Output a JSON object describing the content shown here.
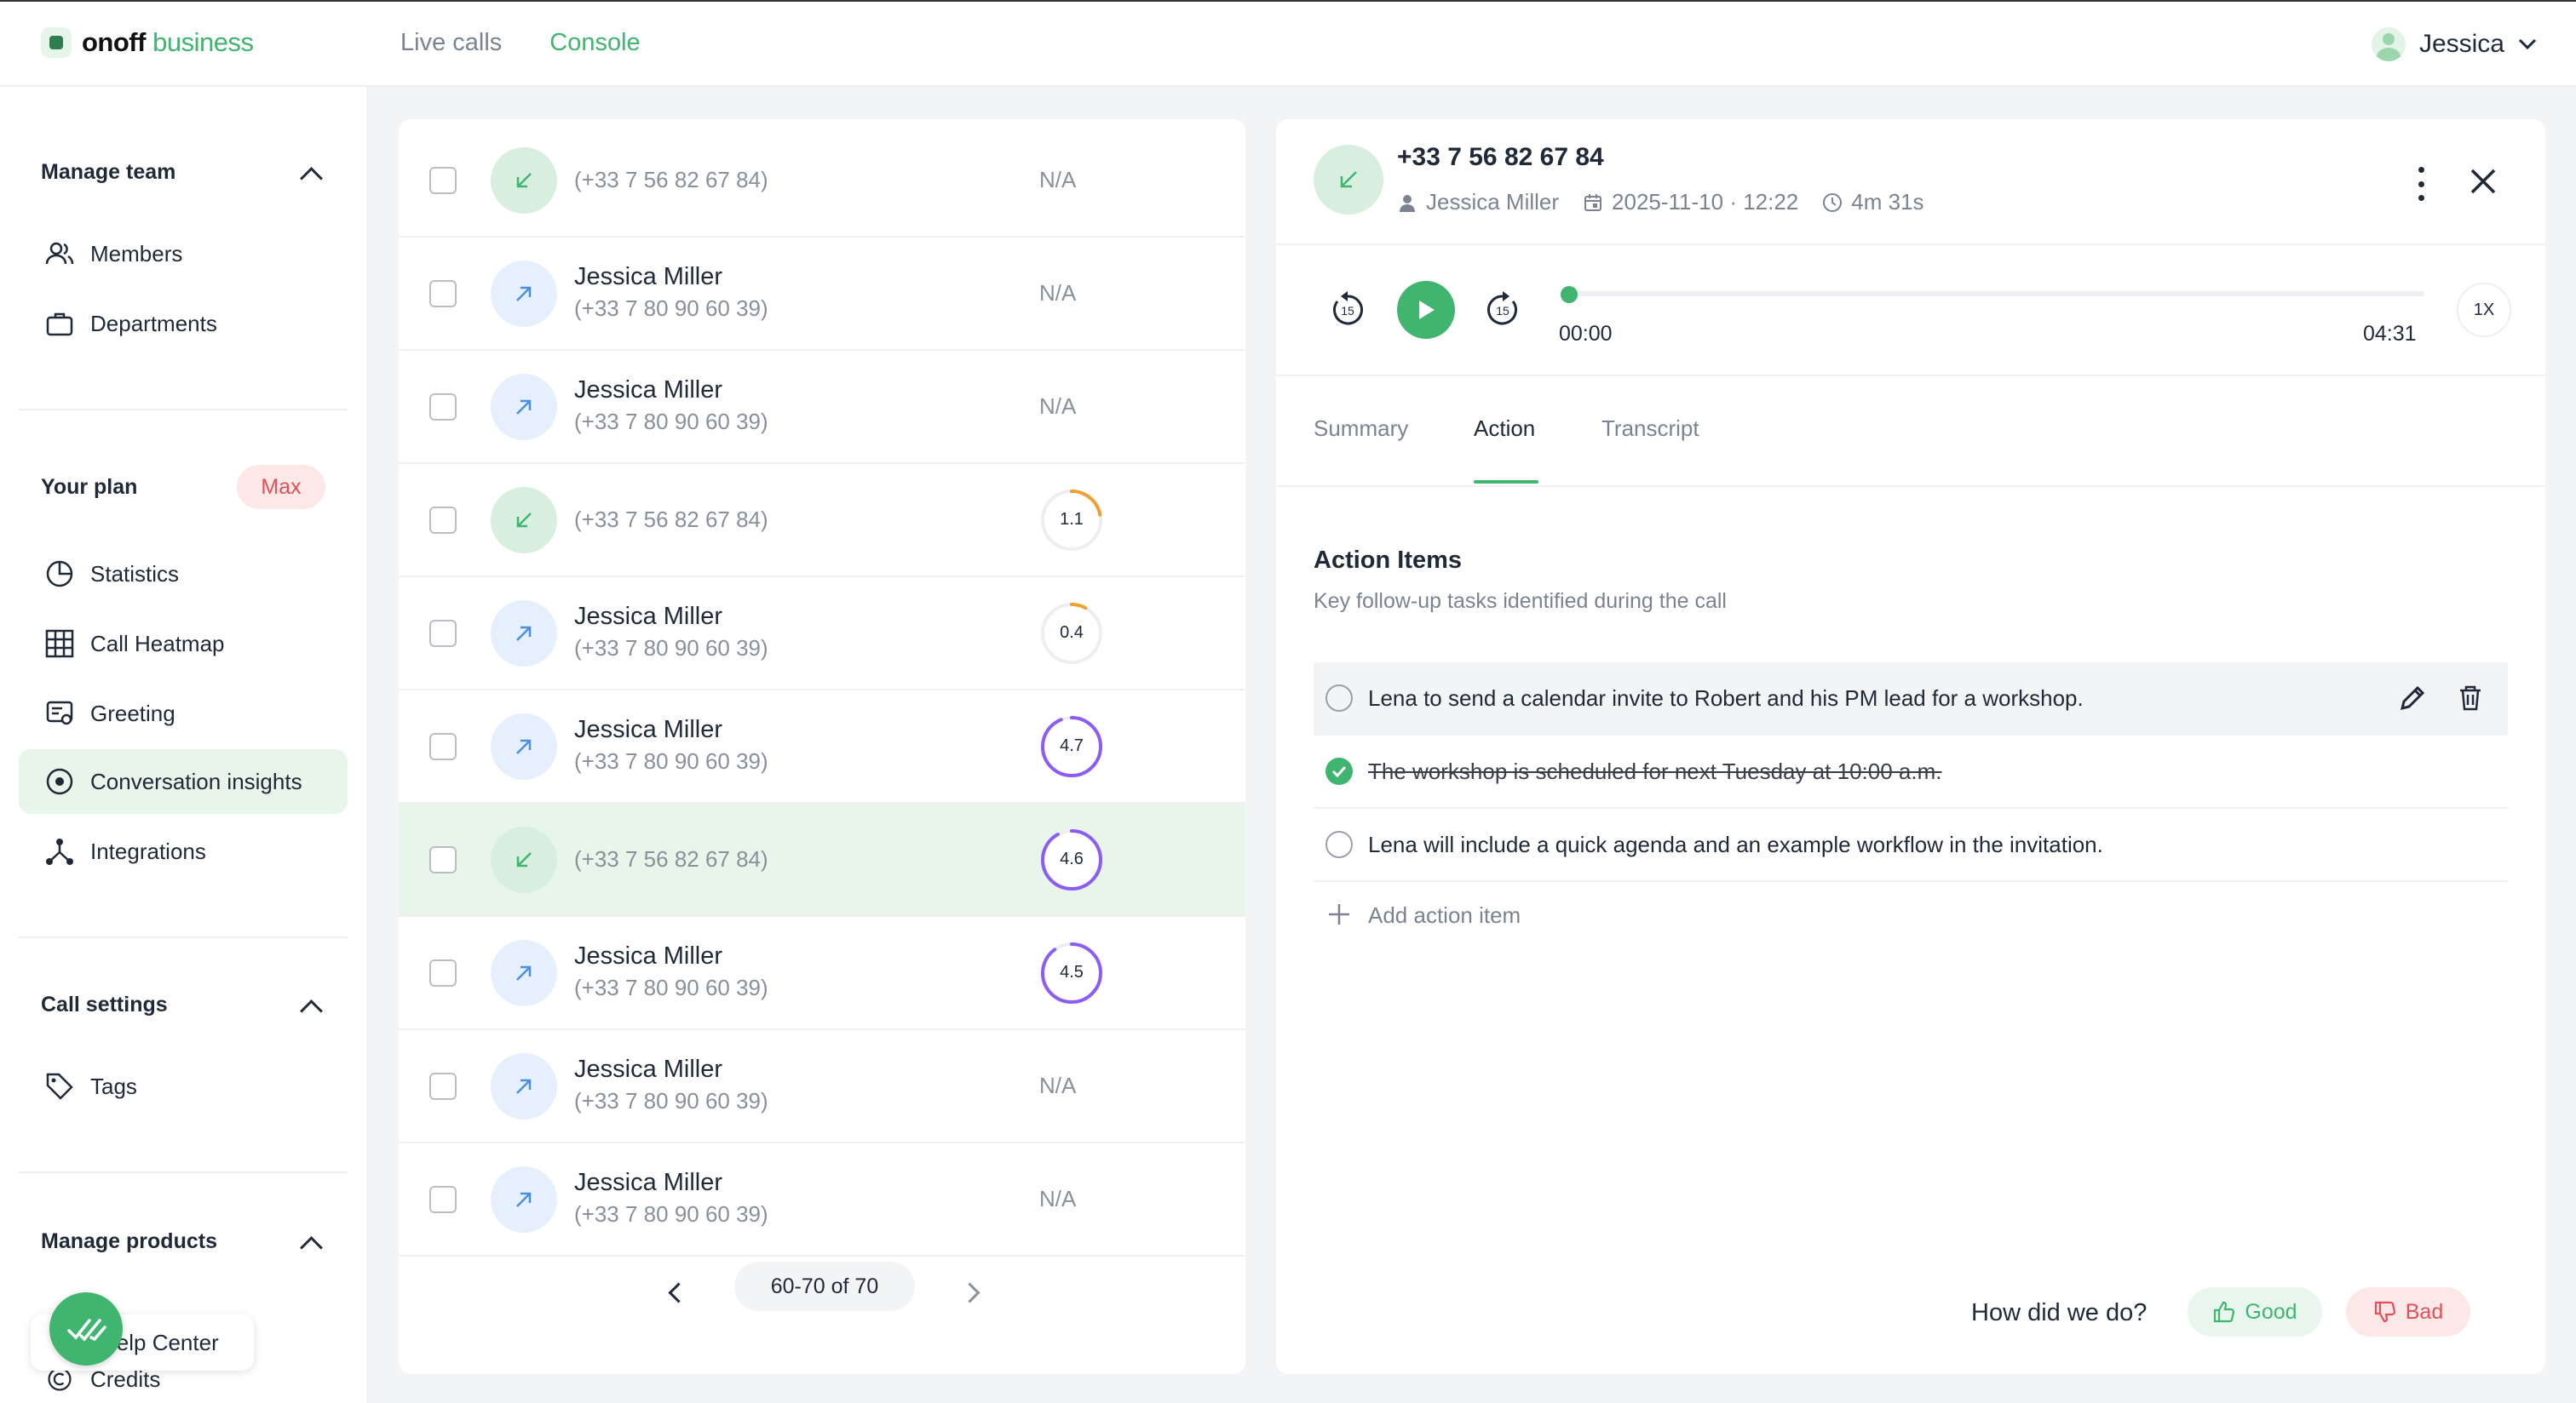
{
  "brand": {
    "name_bold": "onoff",
    "name_light": "business"
  },
  "topnav": {
    "live_calls": "Live calls",
    "console": "Console"
  },
  "user": {
    "name": "Jessica"
  },
  "sidebar": {
    "manage_team": {
      "title": "Manage team",
      "items": [
        {
          "label": "Members",
          "icon": "users-icon"
        },
        {
          "label": "Departments",
          "icon": "briefcase-icon"
        }
      ]
    },
    "plan": {
      "title": "Your plan",
      "badge": "Max",
      "items": [
        {
          "label": "Statistics",
          "icon": "pie-chart-icon"
        },
        {
          "label": "Call Heatmap",
          "icon": "grid-icon"
        },
        {
          "label": "Greeting",
          "icon": "greeting-icon"
        },
        {
          "label": "Conversation insights",
          "icon": "target-icon",
          "active": true
        },
        {
          "label": "Integrations",
          "icon": "integrations-icon"
        }
      ]
    },
    "call_settings": {
      "title": "Call settings",
      "items": [
        {
          "label": "Tags",
          "icon": "tag-icon"
        }
      ]
    },
    "manage_products": {
      "title": "Manage products",
      "items": [
        {
          "label": "Help Center",
          "icon": "help-icon"
        },
        {
          "label": "Credits",
          "icon": "credits-icon"
        }
      ]
    }
  },
  "calls": [
    {
      "dir": "incoming",
      "name": "",
      "phone": "(+33 7 56 82 67 84)",
      "score": "N/A"
    },
    {
      "dir": "outgoing",
      "name": "Jessica Miller",
      "phone": "(+33 7 80 90 60 39)",
      "score": "N/A"
    },
    {
      "dir": "outgoing",
      "name": "Jessica Miller",
      "phone": "(+33 7 80 90 60 39)",
      "score": "N/A"
    },
    {
      "dir": "incoming",
      "name": "",
      "phone": "(+33 7 56 82 67 84)",
      "score": "1.1",
      "score_fraction": 0.22,
      "score_color": "#f0a030"
    },
    {
      "dir": "outgoing",
      "name": "Jessica Miller",
      "phone": "(+33 7 80 90 60 39)",
      "score": "0.4",
      "score_fraction": 0.08,
      "score_color": "#f0a030"
    },
    {
      "dir": "outgoing",
      "name": "Jessica Miller",
      "phone": "(+33 7 80 90 60 39)",
      "score": "4.7",
      "score_fraction": 0.94,
      "score_color": "#8b5cf6"
    },
    {
      "dir": "incoming",
      "name": "",
      "phone": "(+33 7 56 82 67 84)",
      "score": "4.6",
      "score_fraction": 0.92,
      "score_color": "#8b5cf6",
      "selected": true
    },
    {
      "dir": "outgoing",
      "name": "Jessica Miller",
      "phone": "(+33 7 80 90 60 39)",
      "score": "4.5",
      "score_fraction": 0.9,
      "score_color": "#8b5cf6"
    },
    {
      "dir": "outgoing",
      "name": "Jessica Miller",
      "phone": "(+33 7 80 90 60 39)",
      "score": "N/A"
    },
    {
      "dir": "outgoing",
      "name": "Jessica Miller",
      "phone": "(+33 7 80 90 60 39)",
      "score": "N/A"
    }
  ],
  "pagination": {
    "range": "60-70 of 70"
  },
  "detail": {
    "phone": "+33 7 56 82 67 84",
    "contact": "Jessica Miller",
    "datetime": "2025-11-10 · 12:22",
    "duration": "4m 31s",
    "player": {
      "current": "00:00",
      "total": "04:31",
      "speed": "1X",
      "skip_back": "15",
      "skip_forward": "15",
      "progress": 0
    },
    "tabs": [
      {
        "label": "Summary"
      },
      {
        "label": "Action",
        "active": true
      },
      {
        "label": "Transcript"
      }
    ],
    "action_items": {
      "title": "Action Items",
      "subtitle": "Key follow-up tasks identified during the call",
      "items": [
        {
          "text": "Lena to send a calendar invite to Robert and his PM lead for a workshop.",
          "done": false
        },
        {
          "text": "The workshop is scheduled for next Tuesday at 10:00 a.m.",
          "done": true
        },
        {
          "text": "Lena will include a quick agenda and an example workflow in the invitation.",
          "done": false
        }
      ],
      "add_label": "Add action item"
    },
    "feedback": {
      "question": "How did we do?",
      "good": "Good",
      "bad": "Bad"
    }
  },
  "colors": {
    "accent": "#3fb56f",
    "danger": "#e0505a",
    "score_high": "#8b5cf6",
    "score_low": "#f0a030"
  }
}
